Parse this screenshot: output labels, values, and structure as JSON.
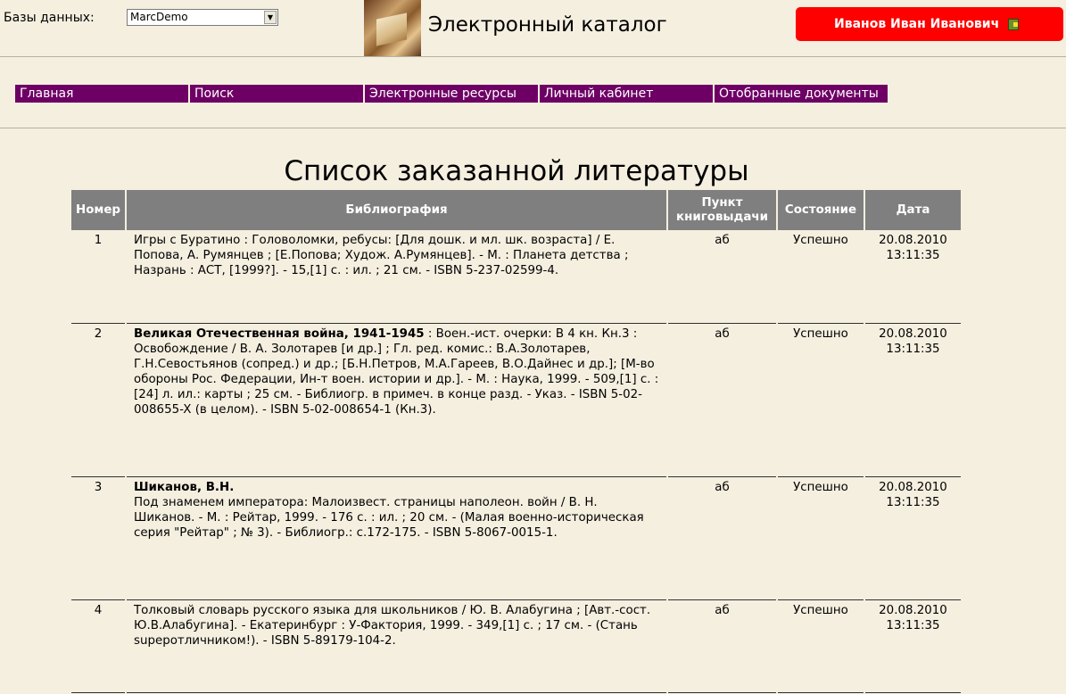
{
  "header": {
    "db_label": "Базы данных:",
    "db_selected": "MarcDemo",
    "site_title": "Электронный каталог",
    "user_name": "Иванов Иван Иванович"
  },
  "nav": [
    {
      "label": "Главная"
    },
    {
      "label": "Поиск"
    },
    {
      "label": "Электронные ресурсы"
    },
    {
      "label": "Личный кабинет"
    },
    {
      "label": "Отобранные документы"
    }
  ],
  "page_title": "Список заказанной литературы",
  "table": {
    "headers": {
      "num": "Номер",
      "biblio": "Библиография",
      "point": "Пункт книговыдачи",
      "state": "Состояние",
      "date": "Дата"
    },
    "rows": [
      {
        "num": "1",
        "title": "",
        "biblio": "Игры с Буратино : Головоломки, ребусы: [Для дошк. и мл. шк. возраста] / Е. Попова, А. Румянцев ; [Е.Попова; Худож. А.Румянцев]. - М. : Планета детства ; Назрань : АСТ, [1999?]. - 15,[1] с. : ил. ; 21 см. - ISBN 5-237-02599-4.",
        "point": "аб",
        "state": "Успешно",
        "date": "20.08.2010",
        "time": "13:11:35"
      },
      {
        "num": "2",
        "title": "Великая Отечественная война, 1941-1945",
        "biblio": " : Воен.-ист. очерки: В 4 кн. Кн.3 : Освобождение / В. А. Золотарев [и др.] ; Гл. ред. комис.: В.А.Золотарев, Г.Н.Севостьянов (сопред.) и др.; [Б.Н.Петров, М.А.Гареев, В.О.Дайнес и др.]; [М-во обороны Рос. Федерации, Ин-т воен. истории и др.]. - М. : Наука, 1999. - 509,[1] с. : [24] л. ил.: карты ; 25 см. - Библиогр. в примеч. в конце разд. - Указ. - ISBN 5-02-008655-X (в целом). - ISBN 5-02-008654-1 (Кн.3).",
        "point": "аб",
        "state": "Успешно",
        "date": "20.08.2010",
        "time": "13:11:35"
      },
      {
        "num": "3",
        "title": "Шиканов, В.Н.",
        "biblio": "Под знаменем императора: Малоизвест. страницы наполеон. войн / В. Н. Шиканов. - М. : Рейтар, 1999. - 176 с. : ил. ; 20 см. - (Малая военно-историческая серия \"Рейтар\" ; № 3). - Библиогр.: с.172-175. - ISBN 5-8067-0015-1.",
        "point": "аб",
        "state": "Успешно",
        "date": "20.08.2010",
        "time": "13:11:35"
      },
      {
        "num": "4",
        "title": "",
        "biblio": "Толковый словарь русского языка для школьников / Ю. В. Алабугина ; [Авт.-сост. Ю.В.Алабугина]. - Екатеринбург : У-Фактория, 1999. - 349,[1] с. ; 17 см. - (Стань supeротличником!). - ISBN 5-89179-104-2.",
        "point": "аб",
        "state": "Успешно",
        "date": "20.08.2010",
        "time": "13:11:35"
      }
    ]
  }
}
